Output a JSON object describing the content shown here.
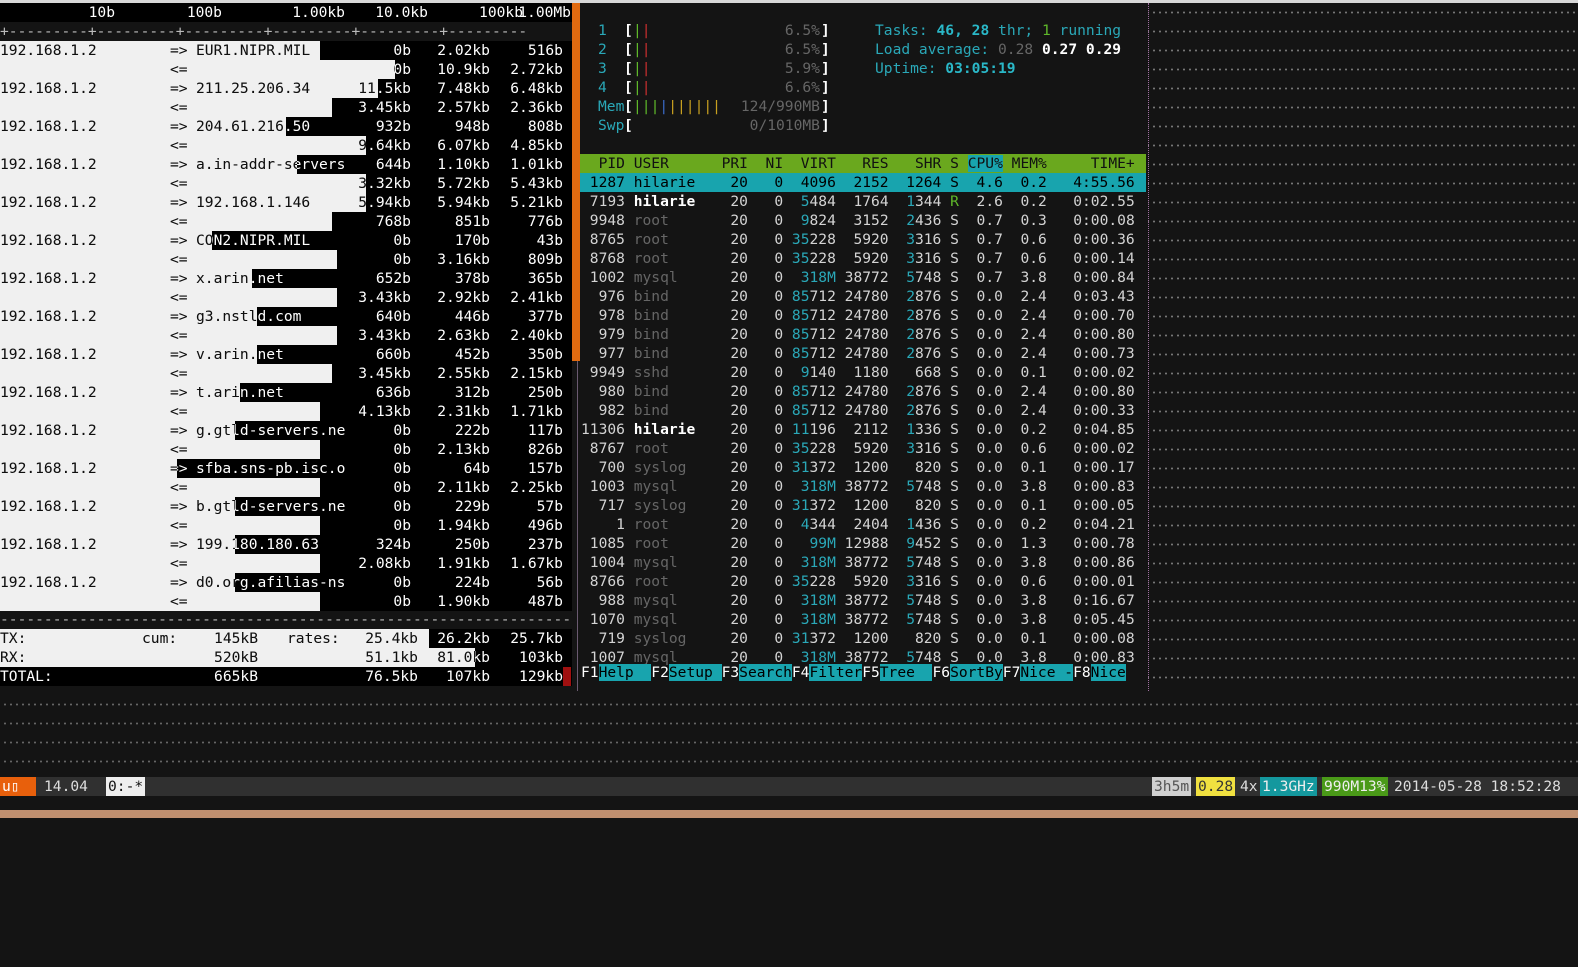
{
  "iftop": {
    "scale": [
      "10b",
      "100b",
      "1.00kb",
      "10.0kb",
      "100kb",
      "1.00Mb"
    ],
    "scale_rule": "+---------+---------+---------+---------+---------+---------",
    "rows": [
      {
        "host": "192.168.1.2",
        "remote": "EUR1.NIPR.MIL",
        "out": [
          "0b",
          "2.02kb",
          "516b"
        ],
        "in": [
          "0b",
          "10.9kb",
          "2.72kb"
        ],
        "bar_out_pct": 56,
        "bar_in_pct": 69
      },
      {
        "host": "192.168.1.2",
        "remote": "211.25.206.34",
        "out": [
          "11.5kb",
          "7.48kb",
          "6.48kb"
        ],
        "in": [
          "3.45kb",
          "2.57kb",
          "2.36kb"
        ],
        "bar_out_pct": 66,
        "bar_in_pct": 58
      },
      {
        "host": "192.168.1.2",
        "remote": "204.61.216.50",
        "out": [
          "932b",
          "948b",
          "808b"
        ],
        "in": [
          "9.64kb",
          "6.07kb",
          "4.85kb"
        ],
        "bar_out_pct": 50,
        "bar_in_pct": 64
      },
      {
        "host": "192.168.1.2",
        "remote": "a.in-addr-servers",
        "out": [
          "644b",
          "1.10kb",
          "1.01kb"
        ],
        "in": [
          "3.32kb",
          "5.72kb",
          "5.43kb"
        ],
        "bar_out_pct": 52,
        "bar_in_pct": 64
      },
      {
        "host": "192.168.1.2",
        "remote": "192.168.1.146",
        "out": [
          "5.94kb",
          "5.94kb",
          "5.21kb"
        ],
        "in": [
          "768b",
          "851b",
          "776b"
        ],
        "bar_out_pct": 64,
        "bar_in_pct": 58
      },
      {
        "host": "192.168.1.2",
        "remote": "CON2.NIPR.MIL",
        "out": [
          "0b",
          "170b",
          "43b"
        ],
        "in": [
          "0b",
          "3.16kb",
          "809b"
        ],
        "bar_out_pct": 37,
        "bar_in_pct": 59
      },
      {
        "host": "192.168.1.2",
        "remote": "x.arin.net",
        "out": [
          "652b",
          "378b",
          "365b"
        ],
        "in": [
          "3.43kb",
          "2.92kb",
          "2.41kb"
        ],
        "bar_out_pct": 44,
        "bar_in_pct": 59
      },
      {
        "host": "192.168.1.2",
        "remote": "g3.nstld.com",
        "out": [
          "640b",
          "446b",
          "377b"
        ],
        "in": [
          "3.43kb",
          "2.63kb",
          "2.40kb"
        ],
        "bar_out_pct": 45,
        "bar_in_pct": 59
      },
      {
        "host": "192.168.1.2",
        "remote": "v.arin.net",
        "out": [
          "660b",
          "452b",
          "350b"
        ],
        "in": [
          "3.45kb",
          "2.55kb",
          "2.15kb"
        ],
        "bar_out_pct": 45,
        "bar_in_pct": 58
      },
      {
        "host": "192.168.1.2",
        "remote": "t.arin.net",
        "out": [
          "636b",
          "312b",
          "250b"
        ],
        "in": [
          "4.13kb",
          "2.31kb",
          "1.71kb"
        ],
        "bar_out_pct": 42,
        "bar_in_pct": 56
      },
      {
        "host": "192.168.1.2",
        "remote": "g.gtld-servers.ne",
        "out": [
          "0b",
          "222b",
          "117b"
        ],
        "in": [
          "0b",
          "2.13kb",
          "826b"
        ],
        "bar_out_pct": 41,
        "bar_in_pct": 56
      },
      {
        "host": "192.168.1.2",
        "remote": "sfba.sns-pb.isc.o",
        "out": [
          "0b",
          "64b",
          "157b"
        ],
        "in": [
          "0b",
          "2.11kb",
          "2.25kb"
        ],
        "bar_out_pct": 31,
        "bar_in_pct": 56
      },
      {
        "host": "192.168.1.2",
        "remote": "b.gtld-servers.ne",
        "out": [
          "0b",
          "229b",
          "57b"
        ],
        "in": [
          "0b",
          "1.94kb",
          "496b"
        ],
        "bar_out_pct": 41,
        "bar_in_pct": 56
      },
      {
        "host": "192.168.1.2",
        "remote": "199.180.180.63",
        "out": [
          "324b",
          "250b",
          "237b"
        ],
        "in": [
          "2.08kb",
          "1.91kb",
          "1.67kb"
        ],
        "bar_out_pct": 41,
        "bar_in_pct": 56
      },
      {
        "host": "192.168.1.2",
        "remote": "d0.org.afilias-ns",
        "out": [
          "0b",
          "224b",
          "56b"
        ],
        "in": [
          "0b",
          "1.90kb",
          "487b"
        ],
        "bar_out_pct": 41,
        "bar_in_pct": 56
      }
    ],
    "out_arrow": "=>",
    "in_arrow": "<=",
    "rule": "-----------------------------------------------------------------",
    "tx": {
      "label": "TX:",
      "cum_label": "cum:",
      "cum": "145kB",
      "rates_label": "rates:",
      "rates": [
        "25.4kb",
        "26.2kb",
        "25.7kb"
      ],
      "bar_pct": 75
    },
    "rx": {
      "label": "RX:",
      "cum": "520kB",
      "rates": [
        "51.1kb",
        "81.0kb",
        "103kb"
      ],
      "bar_pct": 83
    },
    "total": {
      "label": "TOTAL:",
      "cum": "665kB",
      "rates": [
        "76.5kb",
        "107kb",
        "129kb"
      ]
    }
  },
  "htop": {
    "cpus": [
      {
        "label": "1",
        "value": "6.5%"
      },
      {
        "label": "2",
        "value": "6.5%"
      },
      {
        "label": "3",
        "value": "5.9%"
      },
      {
        "label": "4",
        "value": "6.6%"
      }
    ],
    "mem": {
      "label": "Mem",
      "value": "124/990MB"
    },
    "swp": {
      "label": "Swp",
      "value": "0/1010MB"
    },
    "tasks": {
      "label": "Tasks: ",
      "count": "46",
      "sep": ", ",
      "thr": "28",
      "thr_label": " thr; ",
      "running": "1",
      "running_label": " running"
    },
    "load": {
      "label": "Load average: ",
      "l1": "0.28",
      "l5": "0.27",
      "l15": "0.29"
    },
    "uptime": {
      "label": "Uptime: ",
      "value": "03:05:19"
    },
    "columns": [
      "PID",
      "USER",
      "PRI",
      "NI",
      "VIRT",
      "RES",
      "SHR",
      "S",
      "CPU%",
      "MEM%",
      "TIME+"
    ],
    "sort_column": "CPU%",
    "selected_pid": "1287",
    "processes": [
      [
        "1287",
        "hilarie",
        "20",
        "0",
        "4096",
        "2152",
        "1264",
        "S",
        "4.6",
        "0.2",
        "4:55.56"
      ],
      [
        "7193",
        "hilarie",
        "20",
        "0",
        "5484",
        "1764",
        "1344",
        "R",
        "2.6",
        "0.2",
        "0:02.55"
      ],
      [
        "9948",
        "root",
        "20",
        "0",
        "9824",
        "3152",
        "2436",
        "S",
        "0.7",
        "0.3",
        "0:00.08"
      ],
      [
        "8765",
        "root",
        "20",
        "0",
        "35228",
        "5920",
        "3316",
        "S",
        "0.7",
        "0.6",
        "0:00.36"
      ],
      [
        "8768",
        "root",
        "20",
        "0",
        "35228",
        "5920",
        "3316",
        "S",
        "0.7",
        "0.6",
        "0:00.14"
      ],
      [
        "1002",
        "mysql",
        "20",
        "0",
        "318M",
        "38772",
        "5748",
        "S",
        "0.7",
        "3.8",
        "0:00.84"
      ],
      [
        "976",
        "bind",
        "20",
        "0",
        "85712",
        "24780",
        "2876",
        "S",
        "0.0",
        "2.4",
        "0:03.43"
      ],
      [
        "978",
        "bind",
        "20",
        "0",
        "85712",
        "24780",
        "2876",
        "S",
        "0.0",
        "2.4",
        "0:00.70"
      ],
      [
        "979",
        "bind",
        "20",
        "0",
        "85712",
        "24780",
        "2876",
        "S",
        "0.0",
        "2.4",
        "0:00.80"
      ],
      [
        "977",
        "bind",
        "20",
        "0",
        "85712",
        "24780",
        "2876",
        "S",
        "0.0",
        "2.4",
        "0:00.73"
      ],
      [
        "9949",
        "sshd",
        "20",
        "0",
        "9140",
        "1180",
        "668",
        "S",
        "0.0",
        "0.1",
        "0:00.02"
      ],
      [
        "980",
        "bind",
        "20",
        "0",
        "85712",
        "24780",
        "2876",
        "S",
        "0.0",
        "2.4",
        "0:00.80"
      ],
      [
        "982",
        "bind",
        "20",
        "0",
        "85712",
        "24780",
        "2876",
        "S",
        "0.0",
        "2.4",
        "0:00.33"
      ],
      [
        "11306",
        "hilarie",
        "20",
        "0",
        "11196",
        "2112",
        "1336",
        "S",
        "0.0",
        "0.2",
        "0:04.85"
      ],
      [
        "8767",
        "root",
        "20",
        "0",
        "35228",
        "5920",
        "3316",
        "S",
        "0.0",
        "0.6",
        "0:00.02"
      ],
      [
        "700",
        "syslog",
        "20",
        "0",
        "31372",
        "1200",
        "820",
        "S",
        "0.0",
        "0.1",
        "0:00.17"
      ],
      [
        "1003",
        "mysql",
        "20",
        "0",
        "318M",
        "38772",
        "5748",
        "S",
        "0.0",
        "3.8",
        "0:00.83"
      ],
      [
        "717",
        "syslog",
        "20",
        "0",
        "31372",
        "1200",
        "820",
        "S",
        "0.0",
        "0.1",
        "0:00.05"
      ],
      [
        "1",
        "root",
        "20",
        "0",
        "4344",
        "2404",
        "1436",
        "S",
        "0.0",
        "0.2",
        "0:04.21"
      ],
      [
        "1085",
        "root",
        "20",
        "0",
        "99M",
        "12988",
        "9452",
        "S",
        "0.0",
        "1.3",
        "0:00.78"
      ],
      [
        "1004",
        "mysql",
        "20",
        "0",
        "318M",
        "38772",
        "5748",
        "S",
        "0.0",
        "3.8",
        "0:00.86"
      ],
      [
        "8766",
        "root",
        "20",
        "0",
        "35228",
        "5920",
        "3316",
        "S",
        "0.0",
        "0.6",
        "0:00.01"
      ],
      [
        "988",
        "mysql",
        "20",
        "0",
        "318M",
        "38772",
        "5748",
        "S",
        "0.0",
        "3.8",
        "0:16.67"
      ],
      [
        "1070",
        "mysql",
        "20",
        "0",
        "318M",
        "38772",
        "5748",
        "S",
        "0.0",
        "3.8",
        "0:05.45"
      ],
      [
        "719",
        "syslog",
        "20",
        "0",
        "31372",
        "1200",
        "820",
        "S",
        "0.0",
        "0.1",
        "0:00.08"
      ],
      [
        "1007",
        "mysql",
        "20",
        "0",
        "318M",
        "38772",
        "5748",
        "S",
        "0.0",
        "3.8",
        "0:00.83"
      ]
    ],
    "fkeys": [
      {
        "key": "F1",
        "label": "Help  "
      },
      {
        "key": "F2",
        "label": "Setup "
      },
      {
        "key": "F3",
        "label": "Search"
      },
      {
        "key": "F4",
        "label": "Filter"
      },
      {
        "key": "F5",
        "label": "Tree  "
      },
      {
        "key": "F6",
        "label": "SortBy"
      },
      {
        "key": "F7",
        "label": "Nice -"
      },
      {
        "key": "F8",
        "label": "Nice"
      }
    ]
  },
  "statusbar": {
    "session": "u▯",
    "version": "14.04",
    "window": "0:-*",
    "uptime": "3h5m",
    "load": "0.28",
    "cpu_count": "4x",
    "cpu_freq": "1.3GHz",
    "mem": "990M13%",
    "datetime": "2014-05-28 18:52:28"
  },
  "colors": {
    "accent_orange": "#e06a10",
    "htop_header": "#6aa81e",
    "htop_selected": "#18a4ae"
  }
}
